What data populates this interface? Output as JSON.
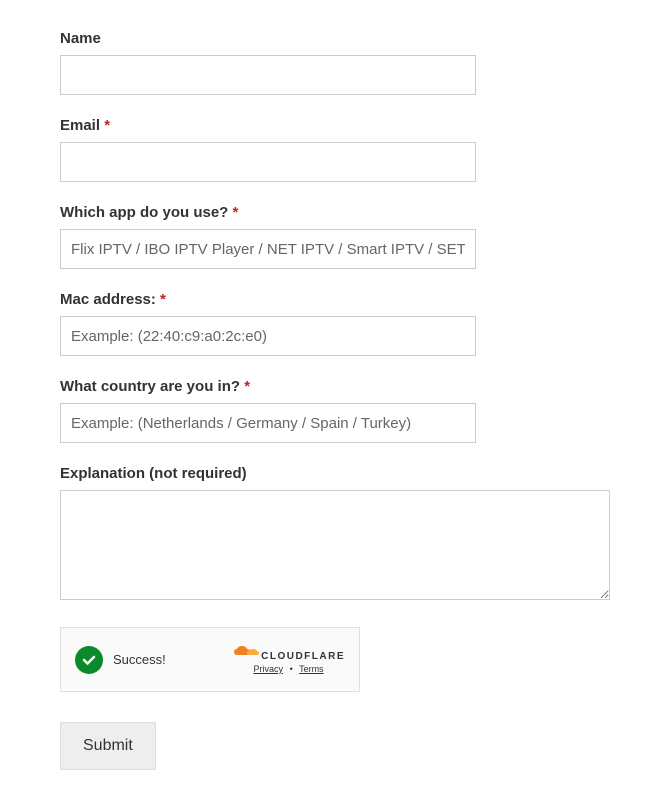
{
  "form": {
    "name": {
      "label": "Name",
      "value": ""
    },
    "email": {
      "label": "Email",
      "required_marker": "*",
      "value": ""
    },
    "app": {
      "label": "Which app do you use?",
      "required_marker": "*",
      "placeholder": "Flix IPTV / IBO IPTV Player / NET IPTV / Smart IPTV / SET IPTV",
      "value": ""
    },
    "mac": {
      "label": "Mac address:",
      "required_marker": "*",
      "placeholder": "Example: (22:40:c9:a0:2c:e0)",
      "value": ""
    },
    "country": {
      "label": "What country are you in?",
      "required_marker": "*",
      "placeholder": "Example: (Netherlands / Germany / Spain / Turkey)",
      "value": ""
    },
    "explanation": {
      "label": "Explanation (not required)",
      "value": ""
    }
  },
  "captcha": {
    "status": "Success!",
    "brand": "CLOUDFLARE",
    "privacy": "Privacy",
    "terms": "Terms"
  },
  "submit": {
    "label": "Submit"
  }
}
